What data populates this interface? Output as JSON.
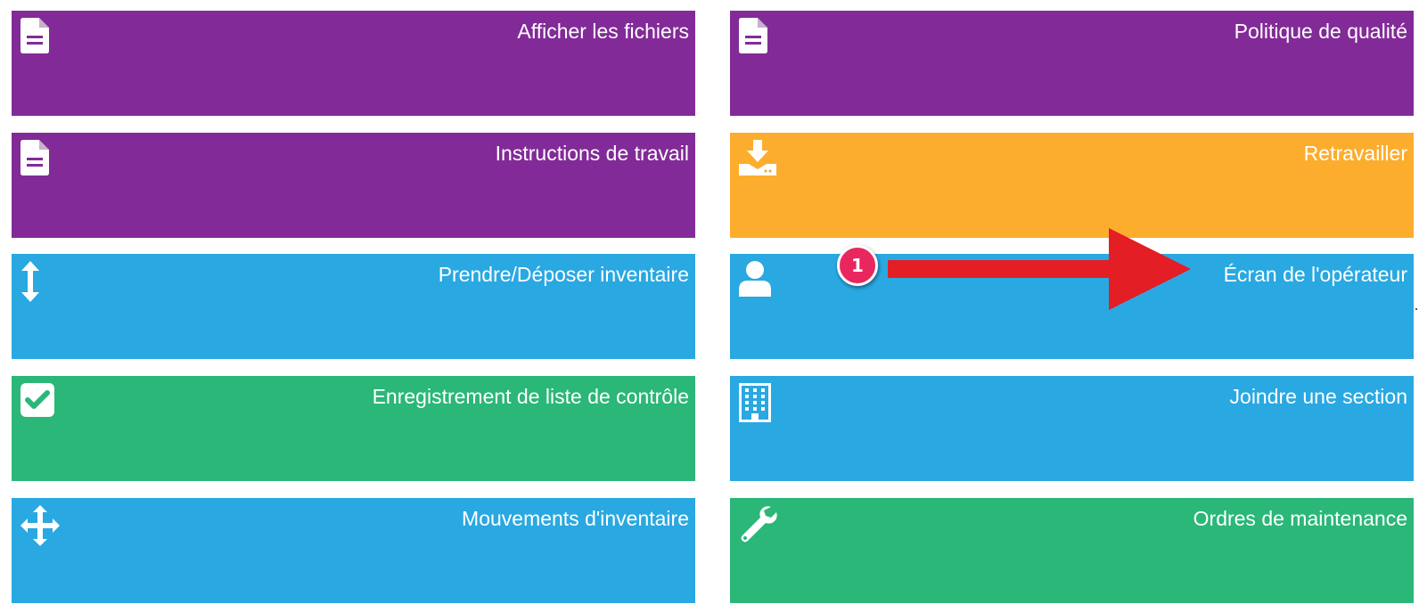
{
  "tiles": {
    "left": [
      {
        "label": "Afficher les fichiers",
        "icon": "file-icon",
        "color": "#822b98"
      },
      {
        "label": "Instructions de travail",
        "icon": "file-icon",
        "color": "#822b98"
      },
      {
        "label": "Prendre/Déposer inventaire",
        "icon": "vertical-arrows-icon",
        "color": "#29a8e2"
      },
      {
        "label": "Enregistrement de liste de contrôle",
        "icon": "checkbox-icon",
        "color": "#2ab778"
      },
      {
        "label": "Mouvements d'inventaire",
        "icon": "move-arrows-icon",
        "color": "#29a8e2"
      }
    ],
    "right": [
      {
        "label": "Politique de qualité",
        "icon": "file-icon",
        "color": "#822b98"
      },
      {
        "label": "Retravailler",
        "icon": "download-tray-icon",
        "color": "#fdad2d"
      },
      {
        "label": "Écran de l'opérateur",
        "icon": "user-icon",
        "color": "#29a8e2"
      },
      {
        "label": "Joindre une section",
        "icon": "building-icon",
        "color": "#29a8e2"
      },
      {
        "label": "Ordres de maintenance",
        "icon": "wrench-icon",
        "color": "#2ab778"
      }
    ]
  },
  "annotation": {
    "badge_number": "1",
    "badge_color": "#e8275f",
    "arrow_color": "#e31e24"
  }
}
